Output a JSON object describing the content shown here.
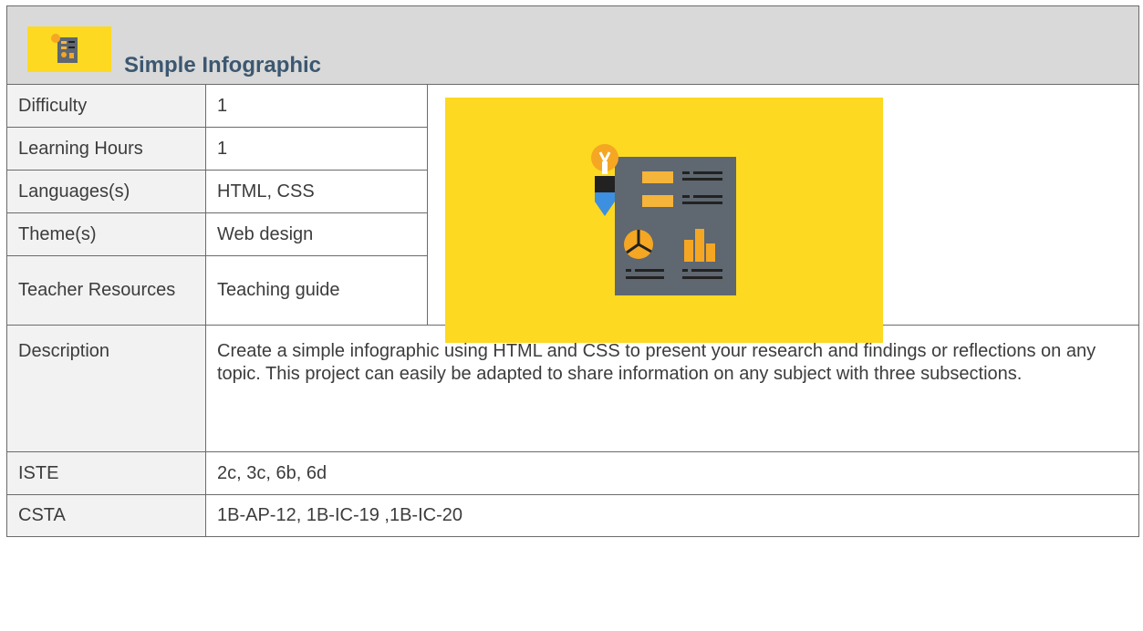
{
  "title": "Simple Infographic",
  "icon": "infographic-icon",
  "colors": {
    "header_bg": "#d9d9d9",
    "label_bg": "#f2f2f2",
    "accent_yellow": "#fdd922",
    "title_color": "#3c5770"
  },
  "rows": [
    {
      "label": "Difficulty",
      "value": "1"
    },
    {
      "label": "Learning Hours",
      "value": "1"
    },
    {
      "label": "Languages(s)",
      "value": "HTML, CSS"
    },
    {
      "label": "Theme(s)",
      "value": "Web design"
    },
    {
      "label": "Teacher Resources",
      "value": "Teaching guide"
    },
    {
      "label": "Description",
      "value": "Create a simple infographic using HTML and CSS to present your research and findings or reflections on any topic. This project can easily be adapted to share information on any subject with three subsections."
    },
    {
      "label": "ISTE",
      "value": "2c, 3c, 6b, 6d"
    },
    {
      "label": "CSTA",
      "value": "1B-AP-12, 1B-IC-19 ,1B-IC-20"
    }
  ]
}
